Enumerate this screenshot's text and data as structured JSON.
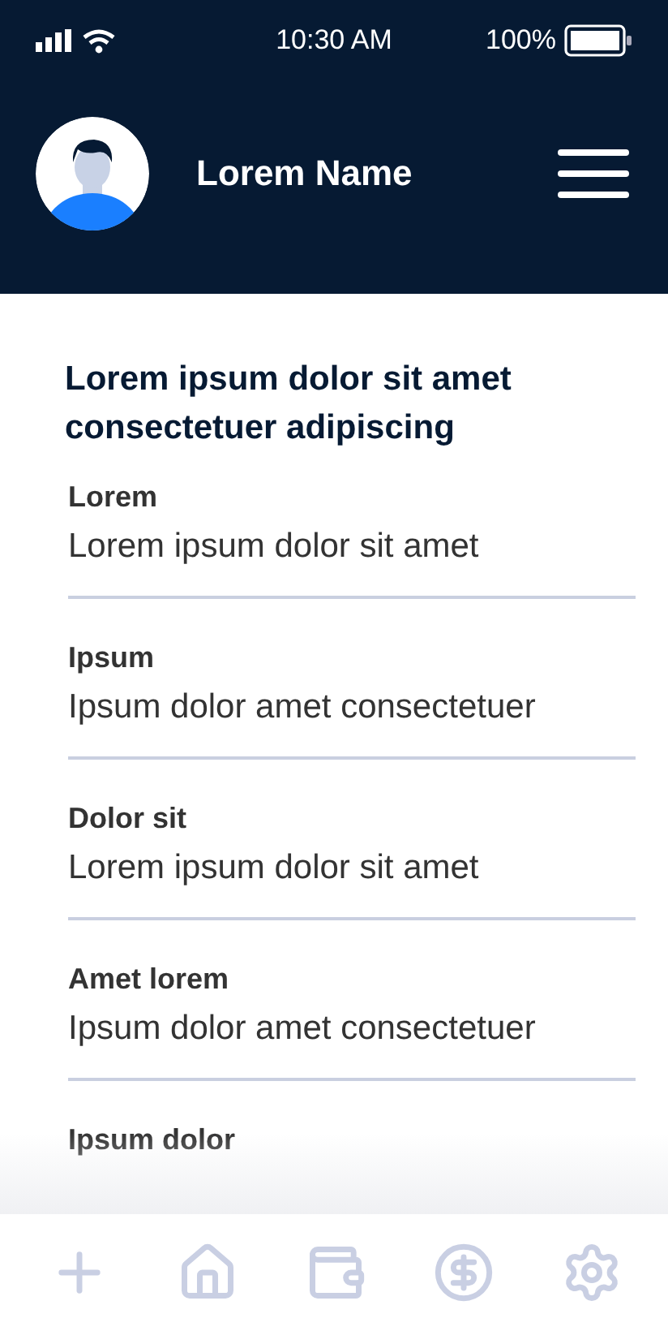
{
  "status_bar": {
    "time": "10:30 AM",
    "battery": "100%"
  },
  "header": {
    "name": "Lorem Name"
  },
  "title": "Lorem ipsum dolor sit amet consectetuer adipiscing",
  "fields": [
    {
      "label": "Lorem",
      "value": "Lorem ipsum dolor sit amet"
    },
    {
      "label": "Ipsum",
      "value": "Ipsum dolor amet consectetuer"
    },
    {
      "label": "Dolor sit",
      "value": "Lorem ipsum dolor sit amet"
    },
    {
      "label": "Amet lorem",
      "value": "Ipsum dolor amet consectetuer"
    },
    {
      "label": "Ipsum dolor"
    }
  ],
  "nav": [
    {
      "kind": "add"
    },
    {
      "kind": "home"
    },
    {
      "kind": "wallet"
    },
    {
      "kind": "money"
    },
    {
      "kind": "settings"
    }
  ]
}
